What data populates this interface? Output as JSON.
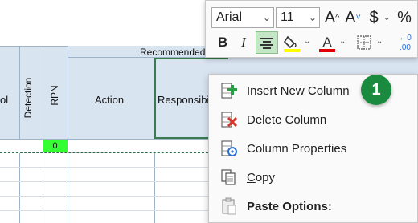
{
  "sheet": {
    "group_header": "Recommended",
    "col_partial": "ol",
    "col_detection": "Detection",
    "col_rpn": "RPN",
    "col_action": "Action",
    "col_responsibility": "Responsibi",
    "rpn_value": "0",
    "rpn_color": "#33ff33"
  },
  "mini_toolbar": {
    "font_name": "Arial",
    "font_size": "11",
    "grow_font": "A^",
    "shrink_font": "A˅",
    "currency": "$",
    "percent": "%",
    "bold": "B",
    "italic": "I",
    "decimal": "←0 .00",
    "fill_color": "#ffff00",
    "font_color": "#e00000"
  },
  "context_menu": {
    "insert_column": "Insert New Column",
    "delete_column": "Delete Column",
    "column_properties": "Column Properties",
    "copy_prefix": "",
    "copy_underlined": "C",
    "copy_rest": "opy",
    "paste_options": "Paste Options:"
  },
  "callout": {
    "number": "1",
    "color": "#1a8a3f"
  }
}
